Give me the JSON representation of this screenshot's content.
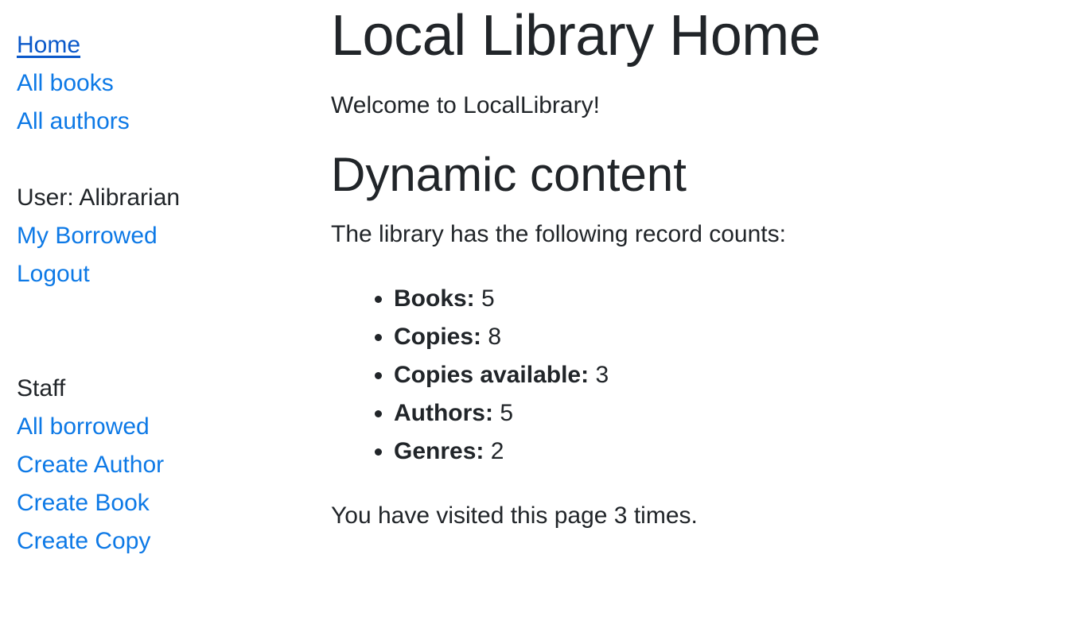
{
  "sidebar": {
    "nav": [
      {
        "label": "Home"
      },
      {
        "label": "All books"
      },
      {
        "label": "All authors"
      }
    ],
    "user": {
      "label": "User: Alibrarian",
      "links": [
        {
          "label": "My Borrowed"
        },
        {
          "label": "Logout"
        }
      ]
    },
    "staff": {
      "label": "Staff",
      "links": [
        {
          "label": "All borrowed"
        },
        {
          "label": "Create Author"
        },
        {
          "label": "Create Book"
        },
        {
          "label": "Create Copy"
        }
      ]
    }
  },
  "main": {
    "title": "Local Library Home",
    "welcome": "Welcome to LocalLibrary!",
    "dynamic_heading": "Dynamic content",
    "counts_intro": "The library has the following record counts:",
    "counts": [
      {
        "label": "Books:",
        "value": "5"
      },
      {
        "label": "Copies:",
        "value": "8"
      },
      {
        "label": "Copies available:",
        "value": "3"
      },
      {
        "label": "Authors:",
        "value": "5"
      },
      {
        "label": "Genres:",
        "value": "2"
      }
    ],
    "visits": "You have visited this page 3 times."
  },
  "colors": {
    "link": "#0d79e6",
    "text": "#212529"
  }
}
